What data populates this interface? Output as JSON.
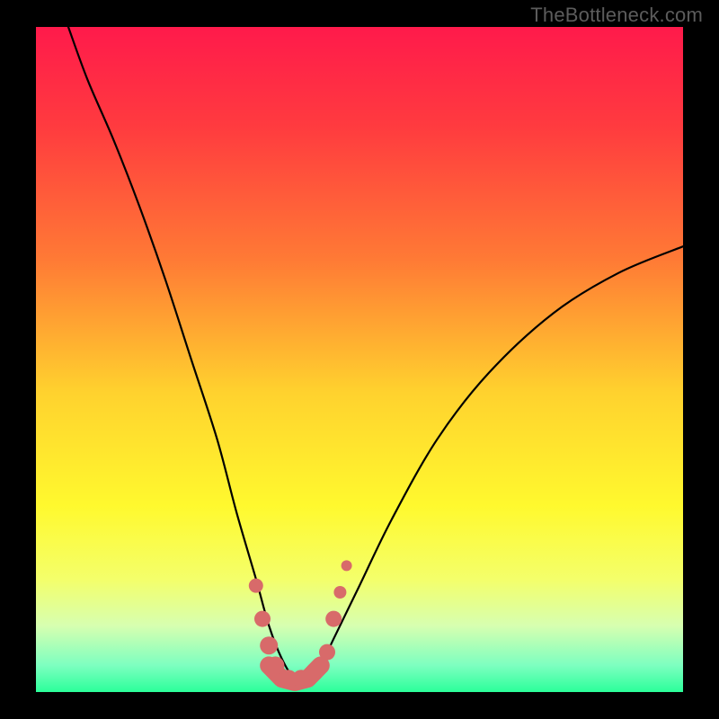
{
  "watermark": {
    "text": "TheBottleneck.com"
  },
  "gradient": {
    "stops": [
      {
        "pct": 0,
        "color": "#ff1a4b"
      },
      {
        "pct": 15,
        "color": "#ff3b3f"
      },
      {
        "pct": 35,
        "color": "#ff7a35"
      },
      {
        "pct": 55,
        "color": "#ffd22e"
      },
      {
        "pct": 72,
        "color": "#fff92e"
      },
      {
        "pct": 83,
        "color": "#f4ff6a"
      },
      {
        "pct": 90,
        "color": "#d7ffb0"
      },
      {
        "pct": 96,
        "color": "#7dffc0"
      },
      {
        "pct": 100,
        "color": "#2bff9a"
      }
    ]
  },
  "marker_color": "#d86a6a",
  "valley_stroke_color": "#d86a6a",
  "chart_data": {
    "type": "line",
    "title": "",
    "xlabel": "",
    "ylabel": "",
    "xlim": [
      0,
      100
    ],
    "ylim": [
      0,
      100
    ],
    "grid": false,
    "series": [
      {
        "name": "bottleneck-curve",
        "x": [
          5,
          8,
          12,
          16,
          20,
          24,
          28,
          31,
          34,
          36,
          38,
          40,
          42,
          44,
          46,
          50,
          55,
          62,
          70,
          80,
          90,
          100
        ],
        "values": [
          100,
          92,
          83,
          73,
          62,
          50,
          38,
          27,
          17,
          10,
          5,
          2,
          2,
          4,
          8,
          16,
          26,
          38,
          48,
          57,
          63,
          67
        ]
      }
    ],
    "markers": [
      {
        "x": 34,
        "y": 16,
        "r": 8
      },
      {
        "x": 35,
        "y": 11,
        "r": 9
      },
      {
        "x": 36,
        "y": 7,
        "r": 10
      },
      {
        "x": 37,
        "y": 4,
        "r": 10
      },
      {
        "x": 39,
        "y": 2,
        "r": 10
      },
      {
        "x": 41,
        "y": 2,
        "r": 10
      },
      {
        "x": 43,
        "y": 3,
        "r": 10
      },
      {
        "x": 45,
        "y": 6,
        "r": 9
      },
      {
        "x": 46,
        "y": 11,
        "r": 9
      },
      {
        "x": 47,
        "y": 15,
        "r": 7
      },
      {
        "x": 48,
        "y": 19,
        "r": 6
      }
    ],
    "valley_floor": {
      "x": [
        36,
        38,
        40,
        42,
        44
      ],
      "y": [
        4,
        2,
        1.5,
        2,
        4
      ]
    },
    "annotations": []
  }
}
